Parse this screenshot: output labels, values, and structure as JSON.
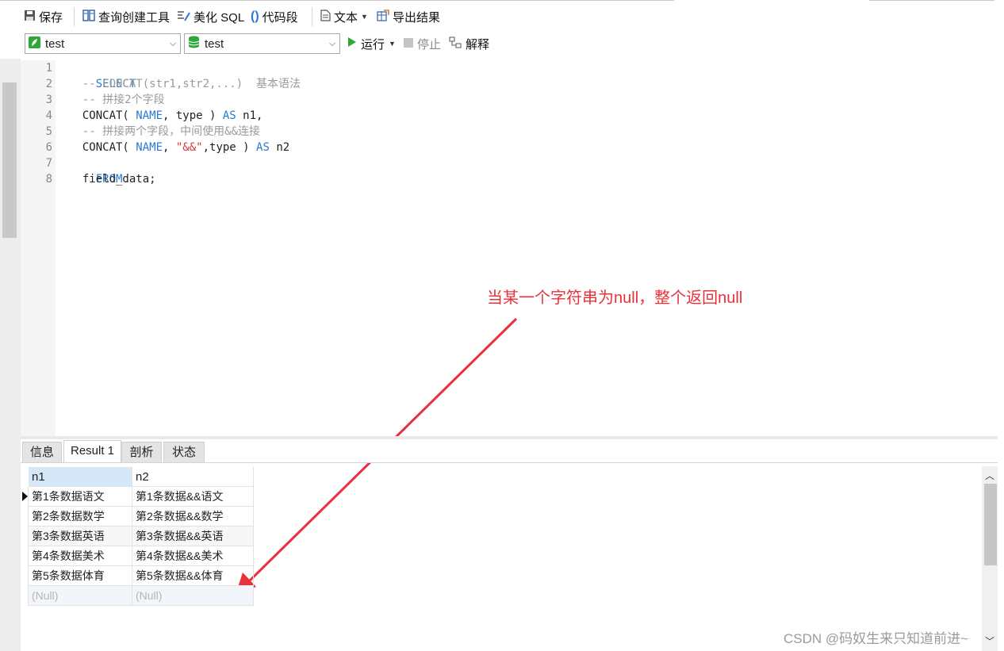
{
  "toolbar": {
    "save": "保存",
    "query_builder": "查询创建工具",
    "beautify_sql": "美化 SQL",
    "code_snippet": "代码段",
    "text": "文本",
    "export_result": "导出结果"
  },
  "connection": {
    "connection_value": "test",
    "database_value": "test",
    "run": "运行",
    "stop": "停止",
    "explain": "解释"
  },
  "editor": {
    "line_numbers": [
      "1",
      "2",
      "3",
      "4",
      "5",
      "6",
      "7",
      "8"
    ],
    "lines": {
      "l1_kw": "SELECT",
      "l2_cm": "  -- CONCAT(str1,str2,...)  基本语法",
      "l3_cm": "  -- 拼接2个字段",
      "l4_a": "  CONCAT( ",
      "l4_name": "NAME",
      "l4_b": ", type ) ",
      "l4_as": "AS",
      "l4_c": " n1,",
      "l5_cm": "  -- 拼接两个字段，中间使用&&连接",
      "l6_a": "  CONCAT( ",
      "l6_name": "NAME",
      "l6_b": ", ",
      "l6_str": "\"&&\"",
      "l6_c": ",type ) ",
      "l6_as": "AS",
      "l6_d": " n2",
      "l7_kw": "FROM",
      "l8": "  field_data;"
    }
  },
  "annotation": "当某一个字符串为null，整个返回null",
  "result_tabs": [
    "信息",
    "Result 1",
    "剖析",
    "状态"
  ],
  "grid": {
    "columns": [
      "n1",
      "n2"
    ],
    "rows": [
      [
        "第1条数据语文",
        "第1条数据&&语文"
      ],
      [
        "第2条数据数学",
        "第2条数据&&数学"
      ],
      [
        "第3条数据英语",
        "第3条数据&&英语"
      ],
      [
        "第4条数据美术",
        "第4条数据&&美术"
      ],
      [
        "第5条数据体育",
        "第5条数据&&体育"
      ],
      [
        "(Null)",
        "(Null)"
      ]
    ]
  },
  "watermark": "CSDN @码奴生来只知道前进~",
  "colors": {
    "keyword": "#2a78d4",
    "comment": "#9a9a9a",
    "string": "#d63a3a",
    "annotation": "#e8313a"
  }
}
